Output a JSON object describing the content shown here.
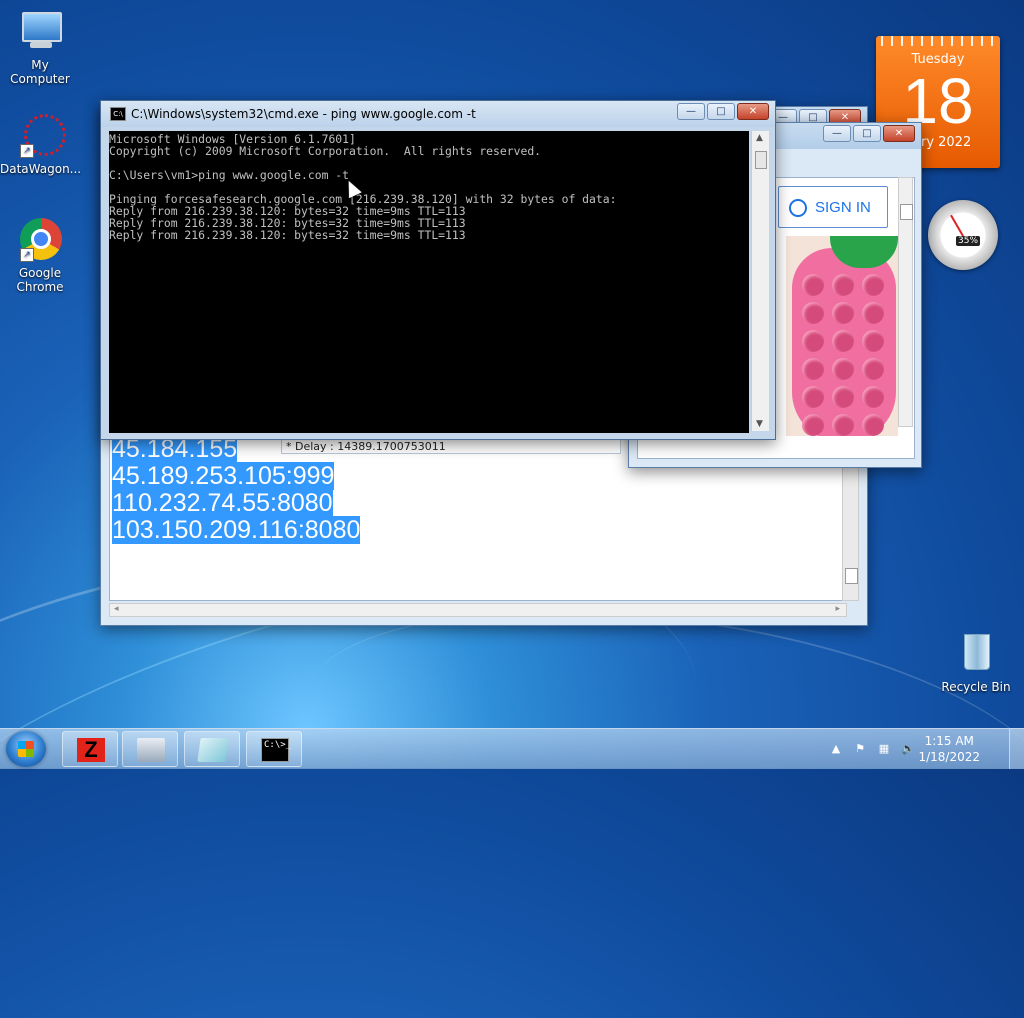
{
  "desktop": {
    "icons": [
      {
        "label": "My Computer"
      },
      {
        "label": "DataWagon..."
      },
      {
        "label": "Google Chrome"
      },
      {
        "label": "Recycle Bin"
      }
    ]
  },
  "calendar_gadget": {
    "weekday": "Tuesday",
    "day": "18",
    "month_year": "uary 2022"
  },
  "cpu_gadget": {
    "percent": "35%"
  },
  "cmd_window": {
    "title": "C:\\Windows\\system32\\cmd.exe - ping  www.google.com -t",
    "console_lines": [
      "Microsoft Windows [Version 6.1.7601]",
      "Copyright (c) 2009 Microsoft Corporation.  All rights reserved.",
      "",
      "C:\\Users\\vm1>ping www.google.com -t",
      "",
      "Pinging forcesafesearch.google.com [216.239.38.120] with 32 bytes of data:",
      "Reply from 216.239.38.120: bytes=32 time=9ms TTL=113",
      "Reply from 216.239.38.120: bytes=32 time=9ms TTL=113",
      "Reply from 216.239.38.120: bytes=32 time=9ms TTL=113"
    ],
    "buttons": {
      "minimize": "—",
      "maximize": "□",
      "close": "✕"
    }
  },
  "back_window": {
    "proxy_lines": [
      "45.184.155",
      "45.189.253.105:999",
      "110.232.74.55:8080",
      "103.150.209.116:8080"
    ]
  },
  "middle_window": {
    "sign_in": "SIGN IN",
    "delay_text": "* Delay :  14389.1700753011"
  },
  "taskbar": {
    "time": "1:15 AM",
    "date": "1/18/2022",
    "cmd_glyph": "C:\\>_",
    "z_glyph": "Z"
  }
}
